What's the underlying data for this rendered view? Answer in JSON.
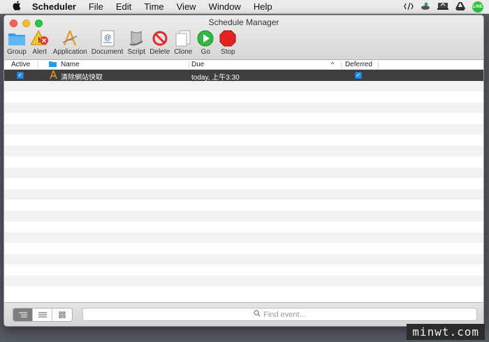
{
  "menubar": {
    "app_name": "Scheduler",
    "items": [
      "File",
      "Edit",
      "Time",
      "View",
      "Window",
      "Help"
    ],
    "line_badge": "LINE"
  },
  "window": {
    "title": "Schedule Manager"
  },
  "toolbar": {
    "buttons": [
      {
        "label": "Group",
        "icon": "folder-icon"
      },
      {
        "label": "Alert",
        "icon": "alert-icon"
      },
      {
        "label": "Application",
        "icon": "application-icon"
      },
      {
        "label": "Document",
        "icon": "document-icon"
      },
      {
        "label": "Script",
        "icon": "script-icon"
      },
      {
        "label": "Delete",
        "icon": "delete-icon"
      },
      {
        "label": "Clone",
        "icon": "clone-icon"
      },
      {
        "label": "Go",
        "icon": "go-icon"
      },
      {
        "label": "Stop",
        "icon": "stop-icon"
      }
    ]
  },
  "table": {
    "columns": {
      "active": "Active",
      "name": "Name",
      "due": "Due",
      "deferred": "Deferred"
    },
    "rows": [
      {
        "active": true,
        "name": "清除網站快取",
        "due": "today, 上午3:30",
        "deferred": true
      }
    ]
  },
  "search": {
    "placeholder": "Find event..."
  },
  "watermark": "minwt.com",
  "colors": {
    "selection": "#3e3e3e",
    "checkbox": "#1e90f0",
    "window_bg": "#ffffff",
    "desktop": "#555b63"
  }
}
